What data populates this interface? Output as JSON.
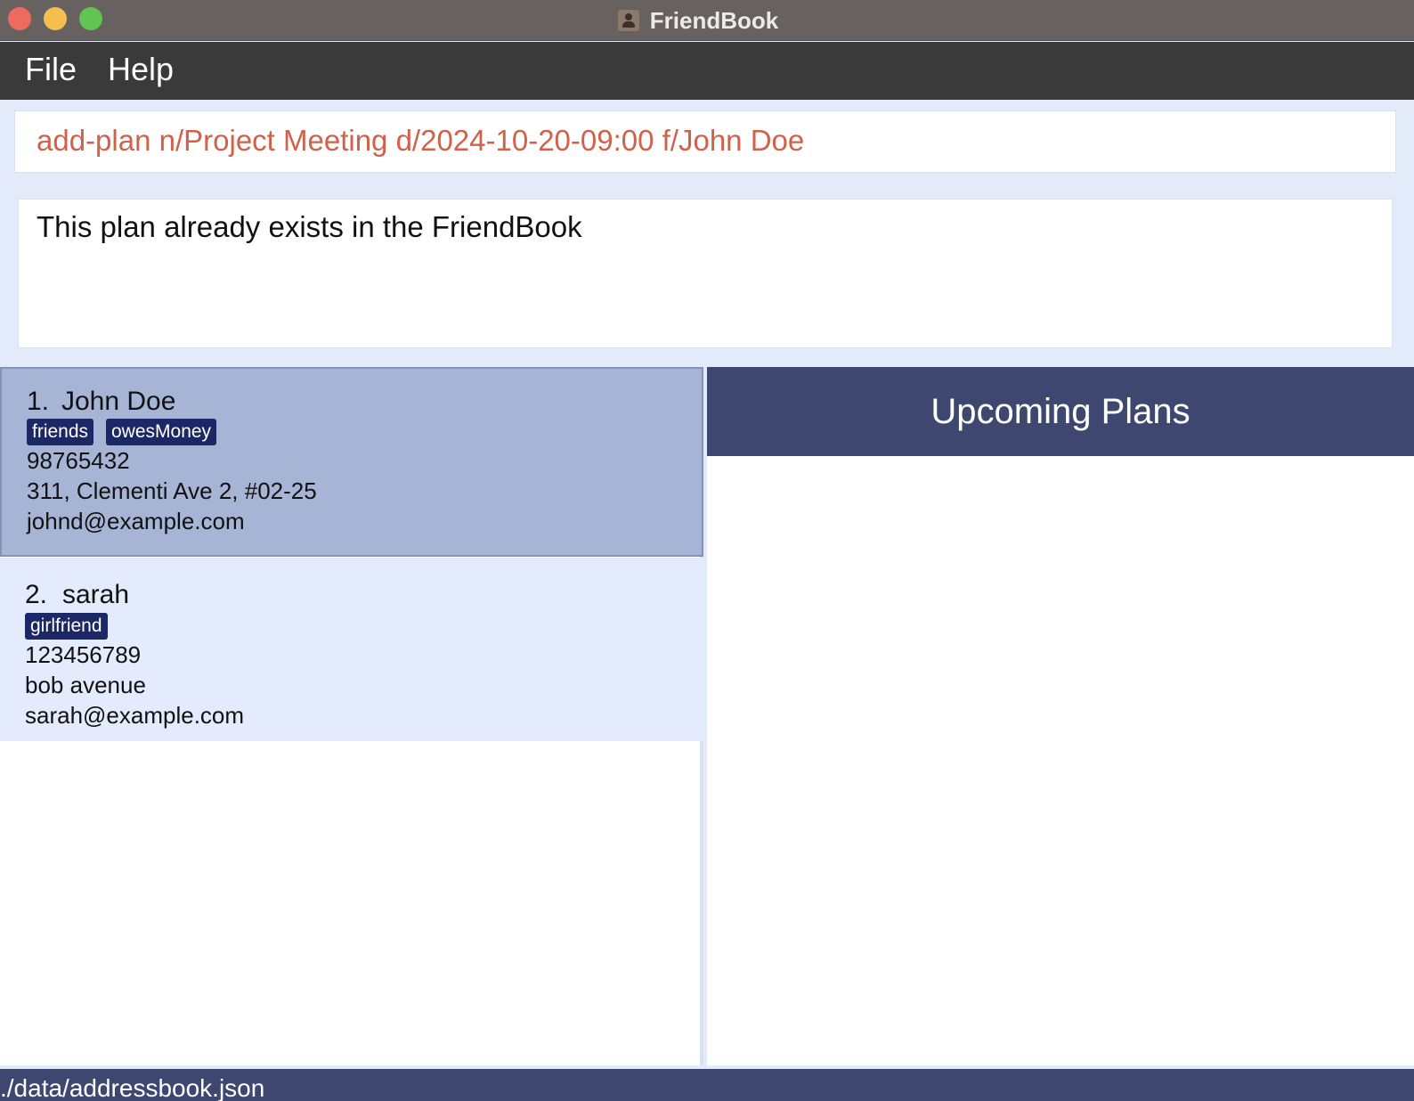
{
  "window": {
    "title": "FriendBook"
  },
  "menu": {
    "file": "File",
    "help": "Help"
  },
  "command": {
    "value": "add-plan n/Project Meeting d/2024-10-20-09:00 f/John Doe"
  },
  "result": {
    "message": "This plan already exists in the FriendBook"
  },
  "persons": [
    {
      "index": "1.",
      "name": "John Doe",
      "tags": [
        "friends",
        "owesMoney"
      ],
      "phone": "98765432",
      "address": "311, Clementi Ave 2, #02-25",
      "email": "johnd@example.com"
    },
    {
      "index": "2.",
      "name": "sarah",
      "tags": [
        "girlfriend"
      ],
      "phone": "123456789",
      "address": "bob avenue",
      "email": "sarah@example.com"
    }
  ],
  "plans": {
    "title": "Upcoming Plans"
  },
  "status": {
    "path": "./data/addressbook.json"
  },
  "colors": {
    "accent": "#3d4770",
    "tag": "#1c2766",
    "command_text": "#d0614a",
    "selected_card": "#a6b5d6"
  }
}
